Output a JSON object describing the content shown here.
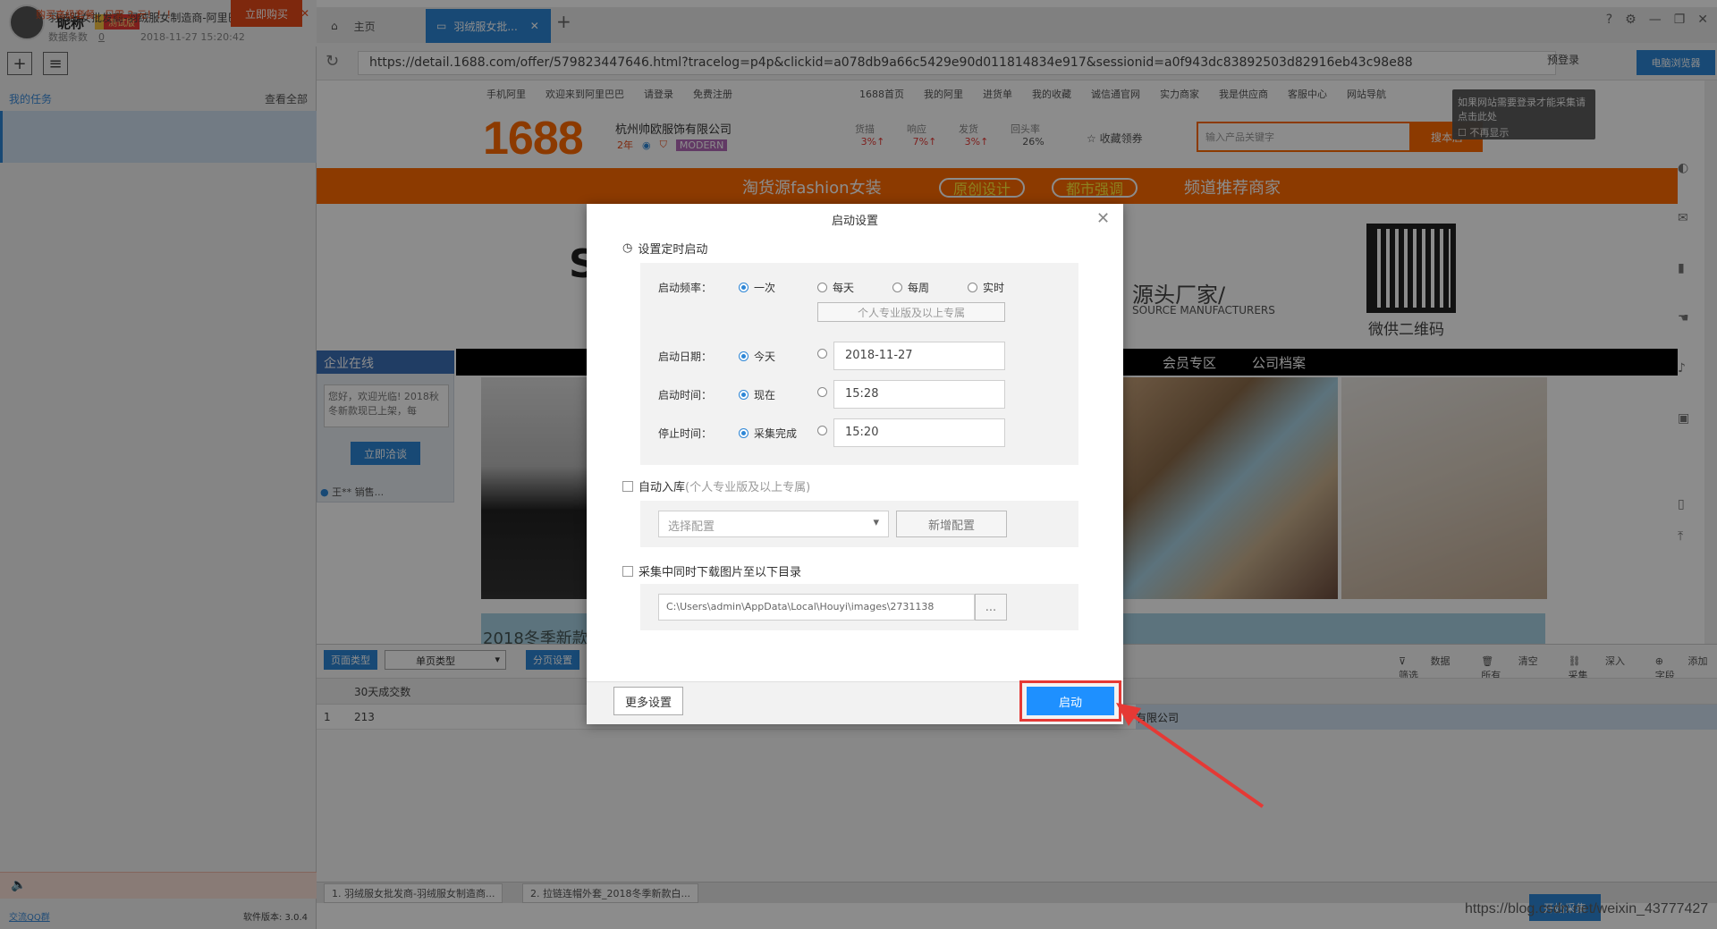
{
  "sidebar": {
    "nickname": "昵称",
    "badge": "测试版",
    "tasks_header": "我的任务",
    "view_all": "查看全部",
    "task": {
      "title": "羽绒服女批发商-羽绒服女制造商-阿里巴巴-...",
      "count_label": "数据条数",
      "count": "0",
      "timestamp": "2018-11-27 15:20:42"
    },
    "promo_text": "购买高级套餐，只需 2 元！！！",
    "promo_button": "立即购买",
    "qq_group": "交流QQ群",
    "version": "软件版本: 3.0.4"
  },
  "browser": {
    "tabs": [
      {
        "label": "主页"
      },
      {
        "label": "羽绒服女批..."
      }
    ],
    "url": "https://detail.1688.com/offer/579823447646.html?tracelog=p4p&clickid=a078db9a66c5429e90d011814834e917&sessionid=a0f943dc83892503d82916eb43c98e88",
    "pre_login": "预登录",
    "browser_mode": "电脑浏览器"
  },
  "site": {
    "nav": [
      "手机阿里",
      "欢迎来到阿里巴巴",
      "请登录",
      "免费注册",
      "1688首页",
      "我的阿里",
      "进货单",
      "我的收藏",
      "诚信通官网",
      "实力商家",
      "我是供应商",
      "客服中心",
      "网站导航"
    ],
    "logo": "1688",
    "company": "杭州帅欧服饰有限公司",
    "years": "2年",
    "brand": "MODERN",
    "metrics": [
      {
        "label": "货描",
        "value": "3%↑"
      },
      {
        "label": "响应",
        "value": "7%↑"
      },
      {
        "label": "发货",
        "value": "3%↑"
      },
      {
        "label": "回头率",
        "value": "26%"
      }
    ],
    "favorite": "收藏领券",
    "search_placeholder": "输入产品关键字",
    "search_button": "搜本店",
    "tip": "如果网站需要登录才能采集请点击此处",
    "tip_checkbox": "不再显示",
    "band_title": "淘货源fashion女装",
    "band_pills": [
      "原创设计",
      "都市强调"
    ],
    "band_right": "频道推荐商家",
    "hero_text": "源头厂家/",
    "hero_sub": "SOURCE MANUFACTURERS",
    "qr_label": "微供二维码",
    "member_zone": "会员专区",
    "company_archive": "公司档案",
    "left_panel_title": "企业在线",
    "left_panel_text": "您好，欢迎光临! 2018秋冬新款现已上架，每",
    "left_panel_button": "立即洽谈",
    "left_panel_user": "王** 销售...",
    "sale_text": "2018冬季新款"
  },
  "bottom_panel": {
    "page_type_label": "页面类型",
    "page_type_value": "单页类型",
    "paging_label": "分页设置",
    "actions": [
      "数据筛选",
      "清空所有",
      "深入采集",
      "添加字段"
    ],
    "column_header": "30天成交数",
    "row_index": "1",
    "row_value": "213",
    "row_company": "有限公司",
    "tabs": [
      "1. 羽绒服女批发商-羽绒服女制造商...",
      "2. 拉链连帽外套_2018冬季新款白..."
    ],
    "start_collect": "开始采集",
    "watermark": "https://blog.csdn.net/weixin_43777427"
  },
  "dialog": {
    "title": "启动设置",
    "schedule_title": "设置定时启动",
    "frequency_label": "启动频率：",
    "frequency_options": [
      "一次",
      "每天",
      "每周",
      "实时"
    ],
    "frequency_selected": "一次",
    "pro_only": "个人专业版及以上专属",
    "date_label": "启动日期：",
    "date_today": "今天",
    "date_value": "2018-11-27",
    "time_label": "启动时间：",
    "time_now": "现在",
    "time_value": "15:28",
    "stop_label": "停止时间：",
    "stop_done": "采集完成",
    "stop_value": "15:20",
    "auto_store": "自动入库",
    "auto_store_note": "(个人专业版及以上专属)",
    "select_config_placeholder": "选择配置",
    "new_config": "新增配置",
    "download_images": "采集中同时下载图片至以下目录",
    "path_value": "C:\\Users\\admin\\AppData\\Local\\Houyi\\images\\2731138",
    "browse": "...",
    "more_settings": "更多设置",
    "start": "启动"
  },
  "colors": {
    "accent": "#2d86d6",
    "orange": "#ff6a00",
    "highlight_red": "#e53935"
  }
}
